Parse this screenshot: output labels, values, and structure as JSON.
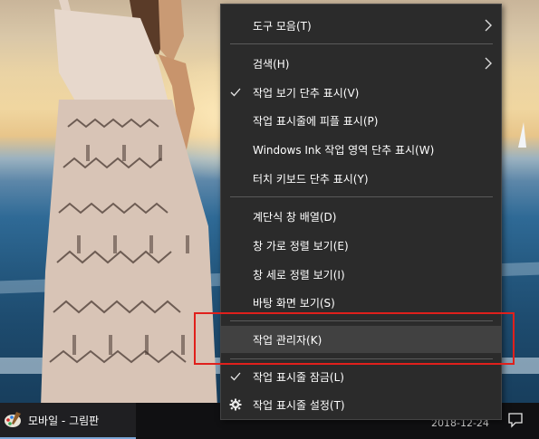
{
  "menu": {
    "items": [
      {
        "label": "도구 모음(T)",
        "checked": false,
        "has_submenu": true,
        "icon": ""
      },
      {
        "label": "검색(H)",
        "checked": false,
        "has_submenu": true,
        "icon": ""
      },
      {
        "label": "작업 보기 단추 표시(V)",
        "checked": true,
        "has_submenu": false,
        "icon": "checkmark-icon"
      },
      {
        "label": "작업 표시줄에 피플 표시(P)",
        "checked": false,
        "has_submenu": false,
        "icon": ""
      },
      {
        "label": "Windows Ink 작업 영역 단추 표시(W)",
        "checked": false,
        "has_submenu": false,
        "icon": ""
      },
      {
        "label": "터치 키보드 단추 표시(Y)",
        "checked": false,
        "has_submenu": false,
        "icon": ""
      },
      {
        "label": "계단식 창 배열(D)",
        "checked": false,
        "has_submenu": false,
        "icon": ""
      },
      {
        "label": "창 가로 정렬 보기(E)",
        "checked": false,
        "has_submenu": false,
        "icon": ""
      },
      {
        "label": "창 세로 정렬 보기(I)",
        "checked": false,
        "has_submenu": false,
        "icon": ""
      },
      {
        "label": "바탕 화면 보기(S)",
        "checked": false,
        "has_submenu": false,
        "icon": ""
      },
      {
        "label": "작업 관리자(K)",
        "checked": false,
        "has_submenu": false,
        "icon": "",
        "highlighted": true
      },
      {
        "label": "작업 표시줄 잠금(L)",
        "checked": true,
        "has_submenu": false,
        "icon": "checkmark-icon"
      },
      {
        "label": "작업 표시줄 설정(T)",
        "checked": false,
        "has_submenu": false,
        "icon": "gear-icon"
      }
    ]
  },
  "taskbar": {
    "app_label": "모바일 - 그림판",
    "app_icon": "paint-palette-icon",
    "clock": "2018-12-24",
    "notification_icon": "action-center-icon"
  },
  "colors": {
    "menu_background": "#2b2b2b",
    "menu_highlight": "#414141",
    "menu_separator": "#5a5a5a",
    "annotation": "#e0201c",
    "taskbar": "#101012"
  }
}
